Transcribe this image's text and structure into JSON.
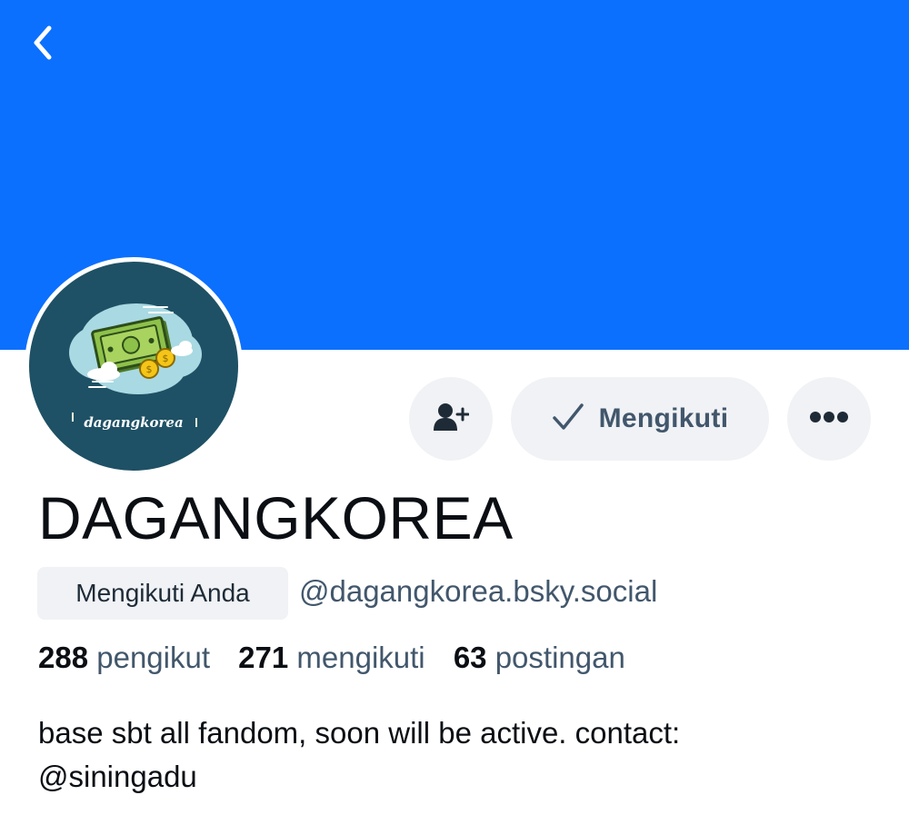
{
  "header": {
    "back_icon": "chevron-left-icon",
    "banner_color": "#0b70fe"
  },
  "avatar": {
    "logo_text": "dagangkorea",
    "background_color": "#1e5165"
  },
  "actions": {
    "add_user_icon": "user-plus-icon",
    "following_label": "Mengikuti",
    "following_icon": "check-icon",
    "more_icon": "ellipsis-icon"
  },
  "profile": {
    "display_name": "DAGANGKOREA",
    "follows_you_label": "Mengikuti Anda",
    "handle": "@dagangkorea.bsky.social"
  },
  "stats": {
    "followers_count": "288",
    "followers_label": "pengikut",
    "following_count": "271",
    "following_label": "mengikuti",
    "posts_count": "63",
    "posts_label": "postingan"
  },
  "bio": {
    "line1": "base sbt all fandom, soon will be active. contact:",
    "line2": "@siningadu"
  },
  "colors": {
    "accent": "#0b70fe",
    "muted_text": "#42576c",
    "pill_background": "#f0f2f5"
  }
}
